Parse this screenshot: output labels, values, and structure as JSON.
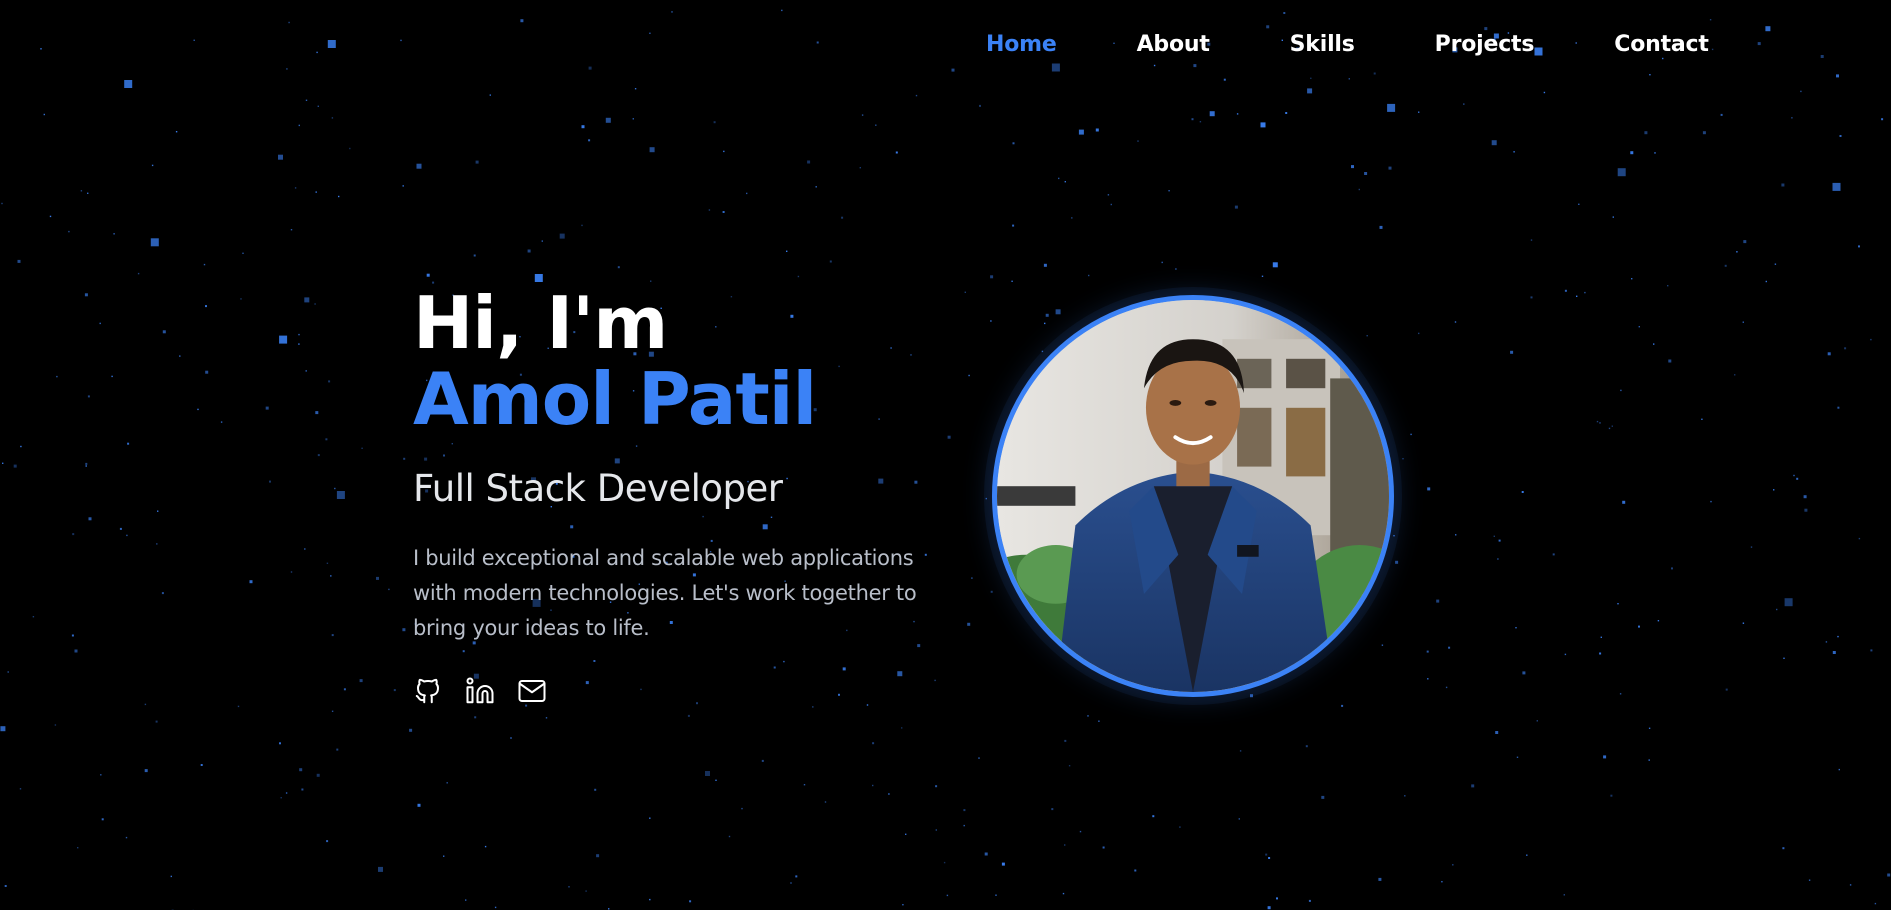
{
  "nav": {
    "items": [
      {
        "label": "Home",
        "active": true
      },
      {
        "label": "About",
        "active": false
      },
      {
        "label": "Skills",
        "active": false
      },
      {
        "label": "Projects",
        "active": false
      },
      {
        "label": "Contact",
        "active": false
      }
    ]
  },
  "hero": {
    "greeting": "Hi, I'm",
    "name": "Amol Patil",
    "role": "Full Stack Developer",
    "bio": "I build exceptional and scalable web applications with modern technologies. Let's work together to bring your ideas to life."
  },
  "socials": [
    {
      "icon": "github-icon"
    },
    {
      "icon": "linkedin-icon"
    },
    {
      "icon": "mail-icon"
    }
  ],
  "colors": {
    "accent": "#3b82f6",
    "background": "#000000",
    "text": "#ffffff",
    "muted": "#b8bec9",
    "star": "#3b82f6"
  }
}
